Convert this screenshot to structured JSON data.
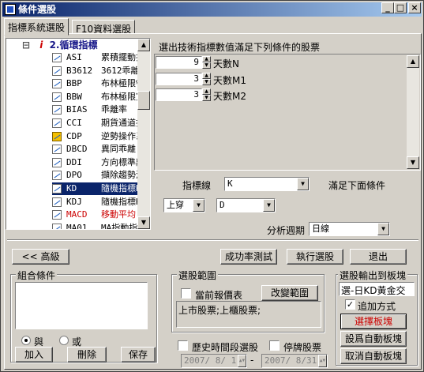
{
  "window": {
    "title": "條件選股"
  },
  "tabs": [
    {
      "label": "指標系統選股"
    },
    {
      "label": "F10資料選股"
    }
  ],
  "tree": {
    "header": {
      "index": "i",
      "label": "2.循環指標"
    },
    "items": [
      {
        "code": "ASI",
        "name": "累積擺動指",
        "color": "#000000"
      },
      {
        "code": "B3612",
        "name": "3612乖離",
        "color": "#000000"
      },
      {
        "code": "BBP",
        "name": "布林極限%",
        "color": "#000000"
      },
      {
        "code": "BBW",
        "name": "布林極限寬",
        "color": "#000000"
      },
      {
        "code": "BIAS",
        "name": "乖離率",
        "color": "#000000"
      },
      {
        "code": "CCI",
        "name": "期貨通道指",
        "color": "#000000"
      },
      {
        "code": "CDP",
        "name": "逆勢操作系",
        "color": "#000000"
      },
      {
        "code": "DBCD",
        "name": "異同乖離",
        "color": "#000000"
      },
      {
        "code": "DDI",
        "name": "方向標準離",
        "color": "#000000"
      },
      {
        "code": "DPO",
        "name": "擷除趨勢波",
        "color": "#000000"
      },
      {
        "code": "KD",
        "name": "隨機指標KD",
        "color": "#000000"
      },
      {
        "code": "KDJ",
        "name": "隨機指標K",
        "color": "#000000"
      },
      {
        "code": "MACD",
        "name": "移動平均",
        "color": "#cc0000"
      },
      {
        "code": "MA01",
        "name": "MA指動指",
        "color": "#000000"
      }
    ]
  },
  "condition": {
    "prompt": "選出技術指標數值滿足下列條件的股票",
    "params": [
      {
        "value": "9",
        "label": "天數N"
      },
      {
        "value": "3",
        "label": "天數M1"
      },
      {
        "value": "3",
        "label": "天數M2"
      }
    ],
    "indicator_line_label": "指標線",
    "indicator_line_value": "K",
    "satisfy_label": "滿足下面條件",
    "operator_value": "上穿",
    "target_value": "D",
    "period_label": "分析週期",
    "period_value": "日線"
  },
  "buttons": {
    "advanced": "<< 高級",
    "success_test": "成功率測試",
    "execute": "執行選股",
    "exit": "退出",
    "add": "加入",
    "delete": "刪除",
    "save": "保存",
    "change_range": "改變範圍",
    "select_block": "選擇板塊",
    "set_auto_block": "設爲自動板塊",
    "cancel_auto_block": "取消自動板塊"
  },
  "combo_group": {
    "label": "組合條件",
    "and_label": "與",
    "or_label": "或"
  },
  "range_group": {
    "label": "選股範圍",
    "current_report_label": "當前報價表",
    "markets_text": "上市股票;上櫃股票;"
  },
  "history": {
    "label": "歷史時間段選股",
    "start_date": "2007/ 8/ 1",
    "dash": "-",
    "end_date": "2007/ 8/31"
  },
  "suspended_label": "停牌股票",
  "output_group": {
    "label": "選股輸出到板塊",
    "target_text": "選-日KD黃金交",
    "append_label": "追加方式"
  }
}
